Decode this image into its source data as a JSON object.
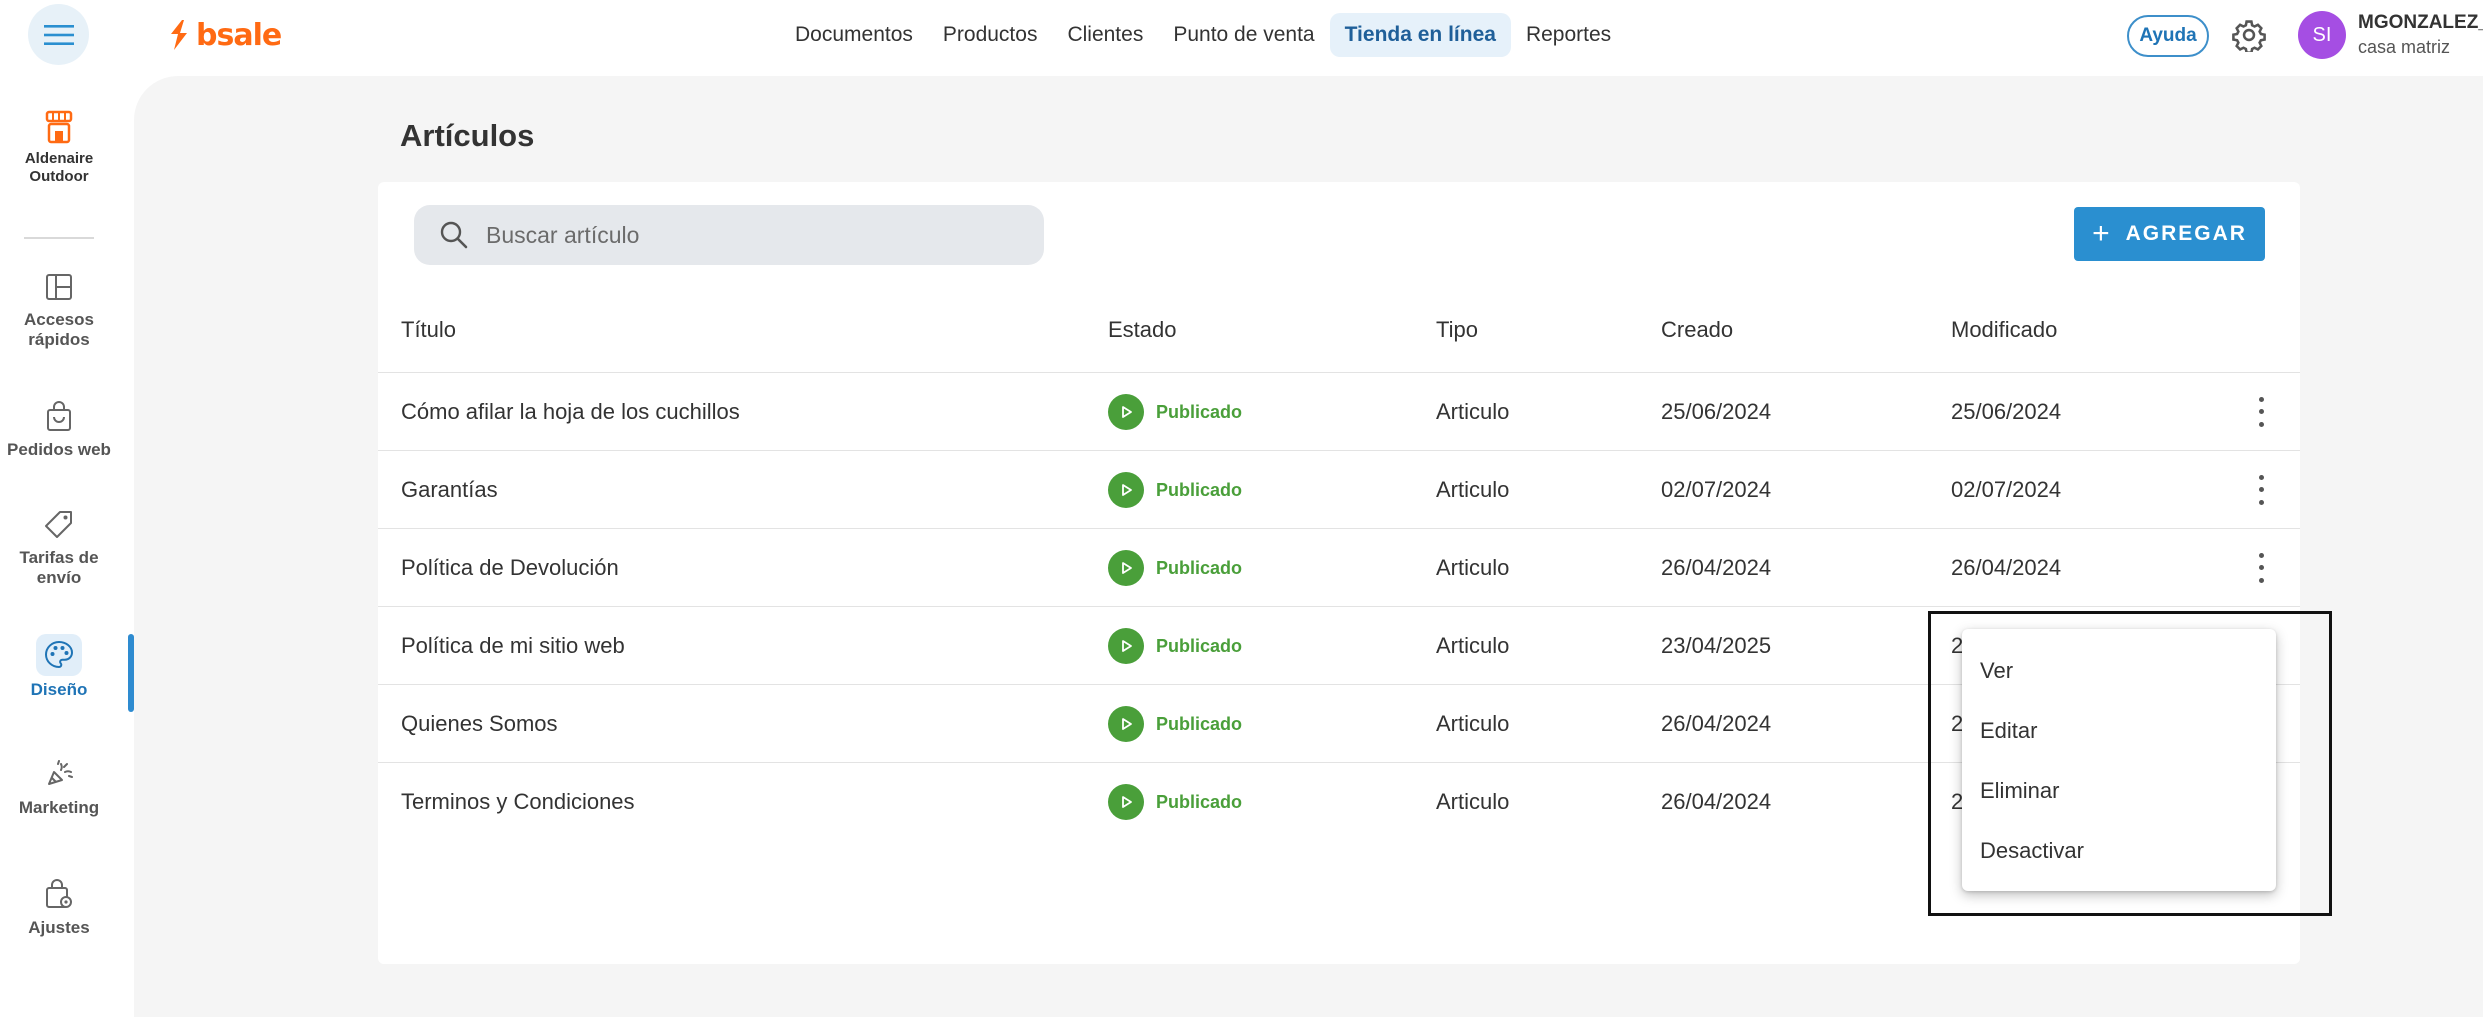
{
  "app": {
    "logo_text": "bsale",
    "brand_color": "#ff6a13",
    "accent_color": "#2a8fd0"
  },
  "topnav": {
    "items": [
      {
        "label": "Documentos",
        "active": false
      },
      {
        "label": "Productos",
        "active": false
      },
      {
        "label": "Clientes",
        "active": false
      },
      {
        "label": "Punto de venta",
        "active": false
      },
      {
        "label": "Tienda en línea",
        "active": true
      },
      {
        "label": "Reportes",
        "active": false
      }
    ],
    "help_label": "Ayuda",
    "avatar_initials": "SI",
    "user_name": "MGONZALEZ_...",
    "user_branch": "casa matriz"
  },
  "sidebar": {
    "company_name": "Aldenaire Outdoor",
    "items": [
      {
        "label": "Accesos rápidos",
        "icon": "layout-icon",
        "active": false
      },
      {
        "label": "Pedidos web",
        "icon": "shopping-bag-icon",
        "active": false
      },
      {
        "label": "Tarifas de envío",
        "icon": "tag-icon",
        "active": false
      },
      {
        "label": "Diseño",
        "icon": "palette-icon",
        "active": true
      },
      {
        "label": "Marketing",
        "icon": "megaphone-icon",
        "active": false
      },
      {
        "label": "Ajustes",
        "icon": "settings-bag-icon",
        "active": false
      }
    ]
  },
  "main": {
    "title": "Artículos",
    "search_placeholder": "Buscar artículo",
    "add_label": "AGREGAR",
    "columns": [
      "Título",
      "Estado",
      "Tipo",
      "Creado",
      "Modificado"
    ],
    "rows": [
      {
        "titulo": "Cómo afilar la hoja de los cuchillos",
        "estado": "Publicado",
        "tipo": "Articulo",
        "creado": "25/06/2024",
        "modificado": "25/06/2024"
      },
      {
        "titulo": "Garantías",
        "estado": "Publicado",
        "tipo": "Articulo",
        "creado": "02/07/2024",
        "modificado": "02/07/2024"
      },
      {
        "titulo": "Política de Devolución",
        "estado": "Publicado",
        "tipo": "Articulo",
        "creado": "26/04/2024",
        "modificado": "26/04/2024"
      },
      {
        "titulo": "Política de mi sitio web",
        "estado": "Publicado",
        "tipo": "Articulo",
        "creado": "23/04/2025",
        "modificado": "2"
      },
      {
        "titulo": "Quienes Somos",
        "estado": "Publicado",
        "tipo": "Articulo",
        "creado": "26/04/2024",
        "modificado": "2"
      },
      {
        "titulo": "Terminos y Condiciones",
        "estado": "Publicado",
        "tipo": "Articulo",
        "creado": "26/04/2024",
        "modificado": "2"
      }
    ],
    "status_color": "#4a9f3a"
  },
  "context_menu": {
    "items": [
      "Ver",
      "Editar",
      "Eliminar",
      "Desactivar"
    ]
  }
}
